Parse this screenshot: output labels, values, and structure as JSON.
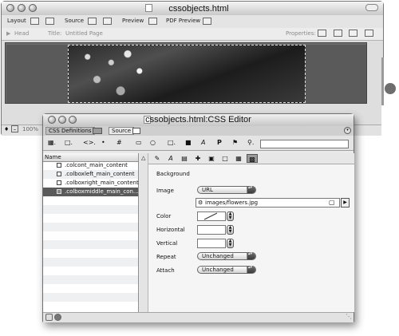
{
  "main_window": {
    "title": "cssobjects.html",
    "toolbar": {
      "layout_label": "Layout",
      "source_label": "Source",
      "preview_label": "Preview",
      "pdf_preview_label": "PDF Preview"
    },
    "head_bar": {
      "head_label": "Head",
      "title_label": "Title:",
      "title_value": "Untitled Page",
      "properties_label": "Properties:"
    },
    "status": {
      "zoom": "100%"
    }
  },
  "css_editor": {
    "title": "cssobjects.html:CSS Editor",
    "tabs": [
      {
        "label": "CSS Definitions"
      },
      {
        "label": "Source"
      }
    ],
    "toolbar_icons": [
      "new-style-icon",
      "new-file-icon",
      "code-icon",
      "dot-icon",
      "hash-icon",
      "folder-icon",
      "comment-icon",
      "import-icon",
      "box-icon",
      "italic-icon",
      "paragraph-icon",
      "flag-icon",
      "search-icon"
    ],
    "list": {
      "header": "Name",
      "items": [
        {
          "label": ".colcont_main_content",
          "selected": false
        },
        {
          "label": ".colboxleft_main_content",
          "selected": false
        },
        {
          "label": ".colboxright_main_content",
          "selected": false
        },
        {
          "label": ".colboxmiddle_main_con…",
          "selected": true
        }
      ]
    },
    "properties": {
      "section": "Background",
      "image_label": "Image",
      "image_type": "URL",
      "image_path": "images/flowers.jpg",
      "color_label": "Color",
      "horizontal_label": "Horizontal",
      "vertical_label": "Vertical",
      "repeat_label": "Repeat",
      "repeat_value": "Unchanged",
      "attach_label": "Attach",
      "attach_value": "Unchanged"
    }
  },
  "colors": {
    "selected_row": "#5a5a5a",
    "canvas": "#6d6d6d",
    "window_chrome": "#dedede"
  }
}
